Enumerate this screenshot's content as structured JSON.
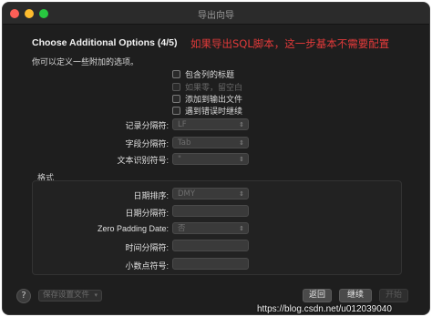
{
  "window": {
    "title": "导出向导"
  },
  "header": {
    "heading": "Choose Additional Options (4/5)",
    "subtitle": "你可以定义一些附加的选项。"
  },
  "annotation": "如果导出SQL脚本，这一步基本不需要配置",
  "options": [
    {
      "label": "包含列的标题",
      "disabled": false
    },
    {
      "label": "如果零，留空白",
      "disabled": true
    },
    {
      "label": "添加到输出文件",
      "disabled": false
    },
    {
      "label": "遇到错误时继续",
      "disabled": false
    }
  ],
  "fields": [
    {
      "label": "记录分隔符:",
      "value": "LF"
    },
    {
      "label": "字段分隔符:",
      "value": "Tab"
    },
    {
      "label": "文本识别符号:",
      "value": "\""
    }
  ],
  "format": {
    "group_label": "格式",
    "fields": [
      {
        "label": "日期排序:",
        "value": "DMY",
        "type": "select"
      },
      {
        "label": "日期分隔符:",
        "value": "",
        "type": "input"
      },
      {
        "label": "Zero Padding Date:",
        "value": "否",
        "type": "select"
      },
      {
        "label": "时间分隔符:",
        "value": "",
        "type": "input"
      },
      {
        "label": "小数点符号:",
        "value": "",
        "type": "input"
      }
    ]
  },
  "footer": {
    "help": "?",
    "save_profile": "保存设置文件",
    "back": "返回",
    "next": "继续",
    "start": "开始"
  },
  "watermark": "https://blog.csdn.net/u012039040"
}
